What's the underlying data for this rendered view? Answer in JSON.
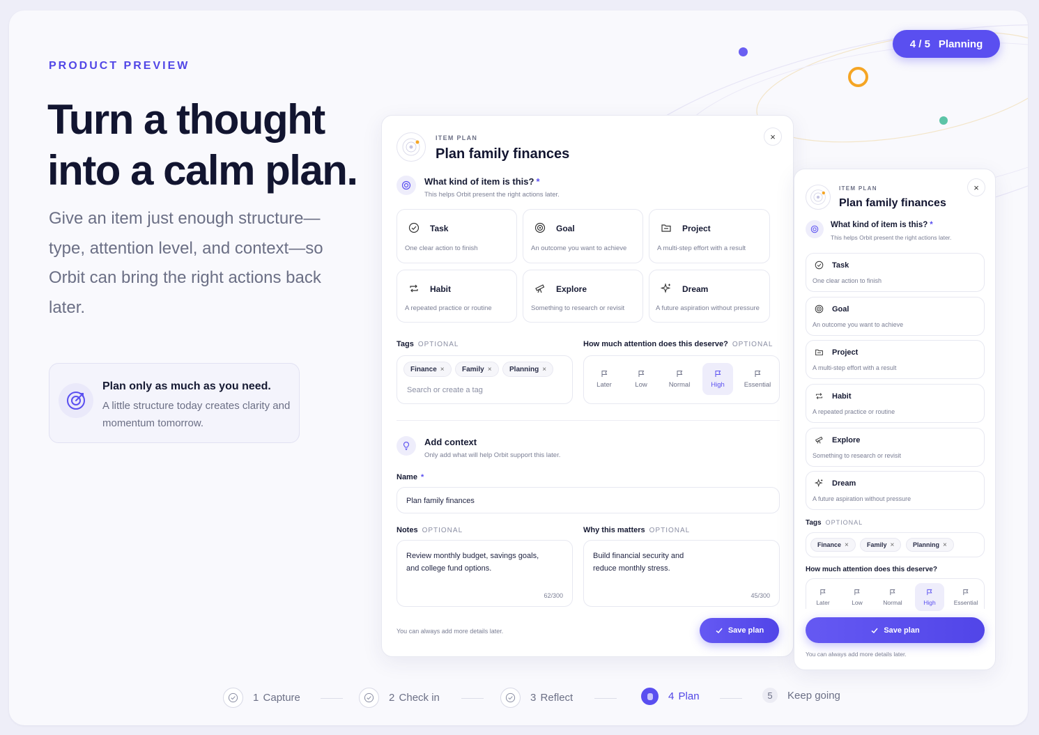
{
  "hero": {
    "eyebrow": "PRODUCT PREVIEW",
    "headline_line1": "Turn a thought",
    "headline_line2": "into a calm plan.",
    "subtext": "Give an item just enough structure—type, attention level, and context—so Orbit can bring the right actions back later.",
    "tip_title": "Plan only as much as you need.",
    "tip_text": "A little structure today creates clarity and momentum tomorrow."
  },
  "progress_badge": {
    "step": "4 / 5",
    "label": "Planning"
  },
  "colors": {
    "accent": "#5a4ff0",
    "orange": "#f5a524",
    "teal": "#5cc4a7"
  },
  "modal": {
    "eyebrow": "ITEM PLAN",
    "title": "Plan family finances",
    "close_label": "×",
    "type_question": "What kind of item is this?",
    "required_mark": "*",
    "type_help": "This helps Orbit present the right actions later.",
    "types": [
      {
        "name": "Task",
        "desc": "One clear action to finish",
        "icon": "check-circle-icon"
      },
      {
        "name": "Goal",
        "desc": "An outcome you want to achieve",
        "icon": "target-icon"
      },
      {
        "name": "Project",
        "desc": "A multi-step effort with a result",
        "icon": "folder-icon"
      },
      {
        "name": "Habit",
        "desc": "A repeated practice or routine",
        "icon": "repeat-icon"
      },
      {
        "name": "Explore",
        "desc": "Something to research or revisit",
        "icon": "telescope-icon"
      },
      {
        "name": "Dream",
        "desc": "A future aspiration without pressure",
        "icon": "sparkle-icon"
      }
    ],
    "tags_label": "Tags",
    "optional": "OPTIONAL",
    "tags": [
      "Finance",
      "Family",
      "Planning"
    ],
    "tag_remove": "×",
    "tag_placeholder": "Search or create a tag",
    "attention_label": "How much attention does this deserve?",
    "attention_levels": [
      "Later",
      "Low",
      "Normal",
      "High",
      "Essential"
    ],
    "attention_selected": "High",
    "context_title": "Add context",
    "context_help": "Only add what will help Orbit support this later.",
    "name_label": "Name",
    "name_value": "Plan family finances",
    "notes_label": "Notes",
    "notes_value": "Review monthly budget, savings goals, and college fund options.",
    "notes_count": "62/300",
    "why_label": "Why this matters",
    "why_value": "Build financial security and reduce monthly stress.",
    "why_count": "45/300",
    "footer_note": "You can always add more details later.",
    "save_label": "Save plan"
  },
  "steps": [
    {
      "num": "1",
      "label": "Capture",
      "state": "done"
    },
    {
      "num": "2",
      "label": "Check in",
      "state": "done"
    },
    {
      "num": "3",
      "label": "Reflect",
      "state": "done"
    },
    {
      "num": "4",
      "label": "Plan",
      "state": "active"
    },
    {
      "num": "5",
      "label": "Keep going",
      "state": "upcoming"
    }
  ]
}
